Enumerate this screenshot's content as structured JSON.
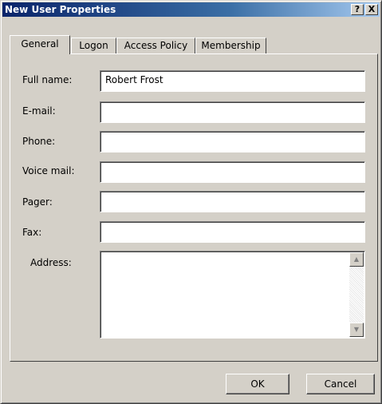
{
  "window": {
    "title": "New User Properties",
    "help_glyph": "?",
    "close_glyph": "X"
  },
  "tabs": [
    {
      "label": "General",
      "active": true
    },
    {
      "label": "Logon",
      "active": false
    },
    {
      "label": "Access Policy",
      "active": false
    },
    {
      "label": "Membership",
      "active": false
    }
  ],
  "fields": {
    "full_name": {
      "label": "Full name:",
      "value": "Robert Frost"
    },
    "email": {
      "label": "E-mail:",
      "value": ""
    },
    "phone": {
      "label": "Phone:",
      "value": ""
    },
    "voice_mail": {
      "label": "Voice mail:",
      "value": ""
    },
    "pager": {
      "label": "Pager:",
      "value": ""
    },
    "fax": {
      "label": "Fax:",
      "value": ""
    },
    "address": {
      "label": "Address:",
      "value": ""
    }
  },
  "buttons": {
    "ok": "OK",
    "cancel": "Cancel"
  },
  "scroll_icons": {
    "up": "▲",
    "down": "▼"
  },
  "colors": {
    "titlebar_start": "#0a246a",
    "titlebar_end": "#a6caf0",
    "face": "#d4d0c8"
  }
}
